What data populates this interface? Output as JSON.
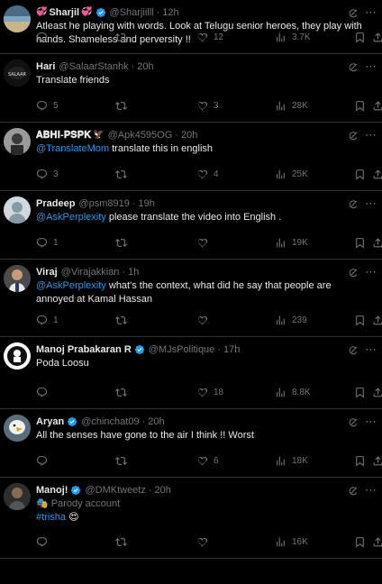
{
  "tweets": [
    {
      "name": "Sharjil",
      "name_emoji": "💞",
      "name_emoji2": "",
      "verified": true,
      "handle": "@Sharjiilll",
      "time": "12h",
      "text_parts": [
        {
          "t": "Atleast he playing with words. Look at Telugu senior heroes, they play with hands. Shameless and perversity !!"
        }
      ],
      "reply": "",
      "retweet": "",
      "like": "12",
      "views": "3.7K"
    },
    {
      "name": "Hari",
      "verified": false,
      "handle": "@SalaarStanhk",
      "time": "20h",
      "text_parts": [
        {
          "t": "Translate friends"
        }
      ],
      "reply": "5",
      "retweet": "",
      "like": "3",
      "views": "28K"
    },
    {
      "name": "𝐀𝐁𝐇𝐈-𝐏𝐒𝐏𝐊",
      "name_emoji": "🦅",
      "verified": false,
      "handle": "@Apk4595OG",
      "time": "20h",
      "text_parts": [
        {
          "t": "@TranslateMom",
          "m": true
        },
        {
          "t": " translate this in english"
        }
      ],
      "reply": "3",
      "retweet": "",
      "like": "4",
      "views": "25K"
    },
    {
      "name": "Pradeep",
      "verified": false,
      "handle": "@psm8919",
      "time": "19h",
      "text_parts": [
        {
          "t": "@AskPerplexity",
          "m": true
        },
        {
          "t": " please translate the video into English ."
        }
      ],
      "reply": "1",
      "retweet": "",
      "like": "",
      "views": "19K"
    },
    {
      "name": "Viraj",
      "verified": false,
      "handle": "@Virajakkian",
      "time": "1h",
      "text_parts": [
        {
          "t": "@AskPerplexity",
          "m": true
        },
        {
          "t": " what's the context, what did he say that people are annoyed at Kamal Hassan"
        }
      ],
      "reply": "1",
      "retweet": "",
      "like": "",
      "views": "239"
    },
    {
      "name": "Manoj Prabakaran R",
      "verified": true,
      "handle": "@MJsPolitique",
      "time": "17h",
      "text_parts": [
        {
          "t": "Poda Loosu"
        }
      ],
      "reply": "",
      "retweet": "",
      "like": "18",
      "views": "8.8K"
    },
    {
      "name": "Aryan",
      "verified": true,
      "handle": "@chinchat09",
      "time": "20h",
      "text_parts": [
        {
          "t": "All the senses have gone to the air I think !! Worst"
        }
      ],
      "reply": "",
      "retweet": "",
      "like": "6",
      "views": "18K"
    },
    {
      "name": "Manoj!",
      "verified": true,
      "handle": "@DMKtweetz",
      "time": "20h",
      "parody": "🎭 Parody account",
      "text_parts": [
        {
          "t": "#trisha",
          "m": true
        },
        {
          "t": " 😍"
        }
      ],
      "reply": "",
      "retweet": "",
      "like": "",
      "views": "16K"
    }
  ],
  "colors": {
    "accent": "#1d9bf0",
    "muted": "#71767b",
    "text": "#e7e9ea",
    "divider": "#2f3336",
    "bg": "#000000"
  }
}
